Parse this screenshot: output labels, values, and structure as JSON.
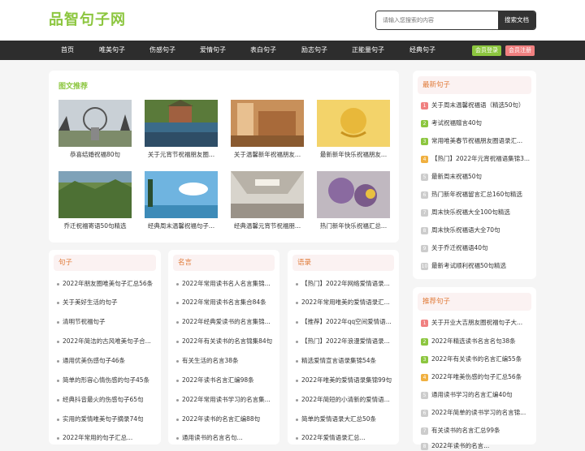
{
  "header": {
    "logo": "品智句子网",
    "search_placeholder": "请输入您搜索的内容",
    "search_button": "搜索文档"
  },
  "nav": {
    "items": [
      "首页",
      "唯美句子",
      "伤感句子",
      "爱情句子",
      "表白句子",
      "励志句子",
      "正能量句子",
      "经典句子"
    ],
    "login": "会员登录",
    "register": "会员注册",
    "login_color": "#8cc63f",
    "register_color": "#f08080"
  },
  "gallery": {
    "title": "图文推荐",
    "items": [
      {
        "caption": "恭喜结婚祝福80句"
      },
      {
        "caption": "关于元宵节祝福朋友圈..."
      },
      {
        "caption": "关于温馨新年祝福朋友..."
      },
      {
        "caption": "最新新年快乐祝福朋友..."
      },
      {
        "caption": "乔迁祝福寄语50句精选"
      },
      {
        "caption": "经典周末温馨祝福句子..."
      },
      {
        "caption": "经典温馨元宵节祝福朋..."
      },
      {
        "caption": "热门新年快乐祝福汇总..."
      }
    ]
  },
  "col1": {
    "title": "句子",
    "items": [
      "2022年朋友圈唯美句子汇总56条",
      "关于美好生活的句子",
      "清明节祝福句子",
      "2022年简洁的古风唯美句子合...",
      "通用优美伤感句子46条",
      "简单的形容心情伤感的句子45条",
      "经典抖音最火的伤感句子65句",
      "实用的爱情唯美句子摘录74句",
      "2022年常用的句子汇总..."
    ]
  },
  "col2": {
    "title": "名言",
    "items": [
      "2022年常用读书名人名言集锦...",
      "2022年常用读书名言集合84条",
      "2022年经典爱读书的名言集锦...",
      "2022年有关读书的名言锦集84句",
      "有关生活的名言38条",
      "2022年读书名言汇编98条",
      "2022年常用读书学习的名言集...",
      "2022年读书的名言汇编88句",
      "通用读书的名言名句..."
    ]
  },
  "col3": {
    "title": "语录",
    "items": [
      "【热门】2022年网络爱情语录...",
      "2022年常用唯美的爱情语录汇...",
      "【推荐】2022年qq空间爱情语...",
      "【热门】2022年浪漫爱情语录...",
      "精选爱情宣言语录集锦54条",
      "2022年唯美的爱情语录集锦99句",
      "2022年简短的小清新的爱情语...",
      "简单的爱情语录大汇总50条",
      "2022年爱情语录汇总..."
    ]
  },
  "latest": {
    "title": "最新句子",
    "items": [
      "关于周末温馨祝福语（精选50句）",
      "考试祝福赠言40句",
      "常用唯美春节祝福朋友圈语录汇...",
      "【热门】2022年元宵祝福语集锦3...",
      "最新周末祝福50句",
      "热门新年祝福留言汇总160句精选",
      "周末快乐祝福大全100句精选",
      "周末快乐祝福语大全70句",
      "关于乔迁祝福语40句",
      "最新考试顺利祝福50句精选"
    ]
  },
  "recommended": {
    "title": "推荐句子",
    "items": [
      "关于开业大吉朋友圈祝福句子大...",
      "2022年精选读书名言名句38条",
      "2022年有关读书的名言汇编55条",
      "2022年唯美伤感的句子汇总56条",
      "通用读书学习的名言汇编40句",
      "2022年简单的读书学习的名言锦...",
      "有关读书的名言汇总99条",
      "2022年读书的名言..."
    ]
  },
  "rank_colors": [
    "#f08080",
    "#8cc63f",
    "#8cc63f",
    "#f0b040",
    "#ccc",
    "#ccc",
    "#ccc",
    "#ccc",
    "#ccc",
    "#ccc"
  ]
}
